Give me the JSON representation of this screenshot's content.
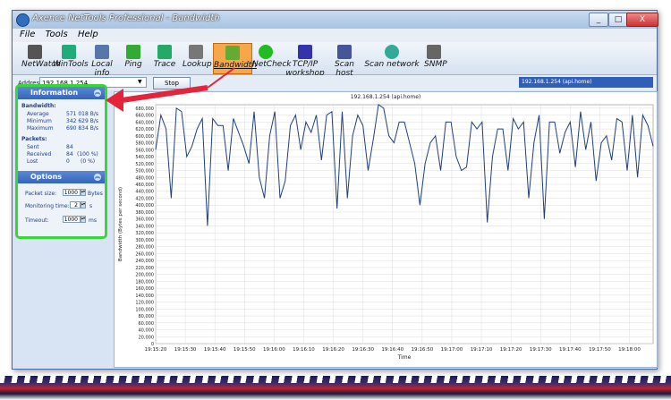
{
  "window": {
    "title": "Axence NetTools Professional - Bandwidth",
    "buttons": {
      "minimize": "_",
      "maximize": "□",
      "close": "X"
    }
  },
  "menu": [
    "File",
    "Tools",
    "Help"
  ],
  "toolbar": [
    {
      "label": "NetWatch",
      "icon": "netwatch-icon"
    },
    {
      "label": "WinTools",
      "icon": "wintools-icon"
    },
    {
      "label": "Local info",
      "icon": "localinfo-icon"
    },
    {
      "label": "Ping",
      "icon": "ping-icon"
    },
    {
      "label": "Trace",
      "icon": "trace-icon"
    },
    {
      "label": "Lookup",
      "icon": "lookup-icon"
    },
    {
      "label": "Bandwidth",
      "icon": "bandwidth-icon",
      "active": true
    },
    {
      "label": "NetCheck",
      "icon": "netcheck-icon"
    },
    {
      "label": "TCP/IP workshop",
      "icon": "tcpip-icon"
    },
    {
      "label": "Scan host",
      "icon": "scanhost-icon"
    },
    {
      "label": "Scan network",
      "icon": "scannetwork-icon"
    },
    {
      "label": "SNMP",
      "icon": "snmp-icon"
    }
  ],
  "address": {
    "label": "Address:",
    "value": "192.168.1.254",
    "stop_label": "Stop",
    "host_display": "192.168.1.254 (api.home)"
  },
  "info_panel": {
    "title": "Information",
    "bandwidth_label": "Bandwidth:",
    "bandwidth": [
      {
        "label": "Average",
        "value": "571 018 B/s"
      },
      {
        "label": "Minimum",
        "value": "342 629 B/s"
      },
      {
        "label": "Maximum",
        "value": "690 834 B/s"
      }
    ],
    "packets_label": "Packets:",
    "packets": [
      {
        "label": "Sent",
        "value": "84",
        "pct": ""
      },
      {
        "label": "Received",
        "value": "84",
        "pct": "(100 %)"
      },
      {
        "label": "Lost",
        "value": "0",
        "pct": "(0 %)"
      }
    ]
  },
  "options_panel": {
    "title": "Options",
    "packet_size_label": "Packet size:",
    "packet_size_value": "1000",
    "packet_size_unit": "Bytes",
    "monitoring_time_label": "Monitoring time:",
    "monitoring_time_value": "2",
    "monitoring_time_unit": "s",
    "timeout_label": "Timeout:",
    "timeout_value": "1000",
    "timeout_unit": "ms"
  },
  "colors": {
    "highlight": "#3ad53a",
    "arrow": "#e5243b",
    "line": "#1f3f7a",
    "active_tool": "#f7a64a"
  },
  "chart_data": {
    "type": "line",
    "title": "192.168.1.254 (api.home)",
    "xlabel": "Time",
    "ylabel": "Bandwidth (Bytes per second)",
    "ylim": [
      0,
      690000
    ],
    "yticks": [
      0,
      20000,
      40000,
      60000,
      80000,
      100000,
      120000,
      140000,
      160000,
      180000,
      200000,
      220000,
      240000,
      260000,
      280000,
      300000,
      320000,
      340000,
      360000,
      380000,
      400000,
      420000,
      440000,
      460000,
      480000,
      500000,
      520000,
      540000,
      560000,
      580000,
      600000,
      620000,
      640000,
      660000,
      680000
    ],
    "xticks": [
      "19:15:20",
      "19:15:30",
      "19:15:40",
      "19:15:50",
      "19:16:00",
      "19:16:10",
      "19:16:20",
      "19:16:30",
      "19:16:40",
      "19:16:50",
      "19:17:00",
      "19:17:10",
      "19:17:20",
      "19:17:30",
      "19:17:40",
      "19:17:50",
      "19:18:00"
    ],
    "xlim_seconds": [
      0,
      172
    ],
    "x_seconds": [
      0,
      2,
      4,
      6,
      8,
      10,
      12,
      14,
      16,
      18,
      20,
      22,
      24,
      26,
      28,
      30,
      32,
      34,
      36,
      38,
      40,
      42,
      44,
      46,
      48,
      50,
      52,
      54,
      56,
      58,
      60,
      62,
      64,
      66,
      68,
      70,
      72,
      74,
      76,
      78,
      80,
      82,
      84,
      86,
      88,
      90,
      92,
      94,
      96,
      98,
      100,
      102,
      104,
      106,
      108,
      110,
      112,
      114,
      116,
      118,
      120,
      122,
      124,
      126,
      128,
      130,
      132,
      134,
      136,
      138,
      140,
      142,
      144,
      146,
      148,
      150,
      152,
      154,
      156,
      158,
      160,
      162,
      164,
      166,
      168,
      170,
      172
    ],
    "values": [
      560000,
      660000,
      620000,
      420000,
      680000,
      670000,
      540000,
      570000,
      620000,
      650000,
      340000,
      650000,
      630000,
      630000,
      500000,
      650000,
      610000,
      570000,
      520000,
      670000,
      480000,
      420000,
      600000,
      670000,
      420000,
      470000,
      630000,
      660000,
      560000,
      640000,
      610000,
      660000,
      530000,
      660000,
      670000,
      390000,
      670000,
      420000,
      600000,
      660000,
      630000,
      500000,
      590000,
      690000,
      680000,
      600000,
      580000,
      640000,
      640000,
      580000,
      520000,
      400000,
      520000,
      580000,
      600000,
      500000,
      640000,
      640000,
      540000,
      500000,
      510000,
      640000,
      620000,
      640000,
      350000,
      540000,
      620000,
      620000,
      500000,
      650000,
      620000,
      640000,
      420000,
      580000,
      660000,
      360000,
      640000,
      640000,
      550000,
      610000,
      640000,
      510000,
      670000,
      560000,
      640000,
      470000,
      580000,
      600000,
      530000,
      650000,
      640000,
      500000,
      660000,
      480000,
      660000,
      630000,
      570000
    ]
  }
}
